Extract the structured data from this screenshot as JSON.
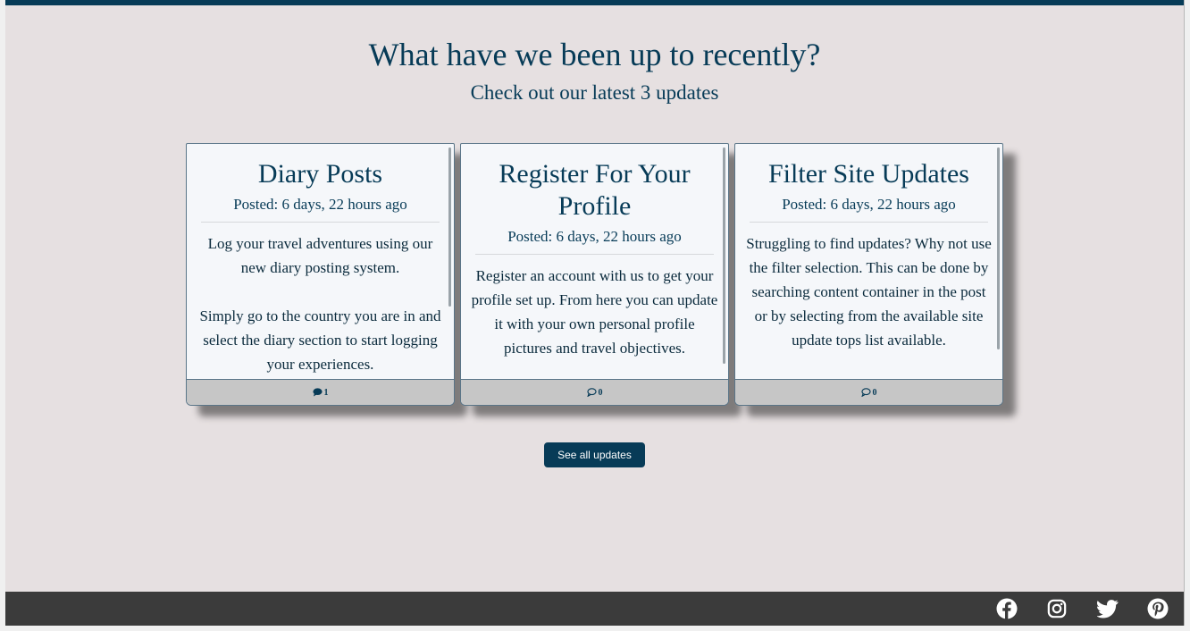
{
  "section": {
    "heading": "What have we been up to recently?",
    "subheading": "Check out our latest 3 updates"
  },
  "cards": [
    {
      "title": "Diary Posts",
      "date": "Posted: 6 days, 22 hours ago",
      "text": "Log your travel adventures using our new diary posting system.\n\nSimply go to the country you are in and select the diary section to start logging your experiences.",
      "comments": "1",
      "comment_icon": "filled-comment-icon"
    },
    {
      "title": "Register For Your Profile",
      "date": "Posted: 6 days, 22 hours ago",
      "text": "Register an account with us to get your profile set up. From here you can update it with your own personal profile pictures and travel objectives.",
      "comments": "0",
      "comment_icon": "outline-comment-icon"
    },
    {
      "title": "Filter Site Updates",
      "date": "Posted: 6 days, 22 hours ago",
      "text": "Struggling to find updates? Why not use the filter selection. This can be done by searching content container in the post or by selecting from the available site update tops list available.",
      "comments": "0",
      "comment_icon": "outline-comment-icon"
    }
  ],
  "button": {
    "see_all": "See all updates"
  },
  "footer": {
    "social_icons": [
      "facebook-icon",
      "instagram-icon",
      "twitter-icon",
      "pinterest-icon"
    ]
  },
  "colors": {
    "accent": "#073b57",
    "background": "#e6e0e1",
    "footer": "#3b3b3b",
    "card": "#f5f7fa",
    "card_footer": "#c6c6c6"
  }
}
